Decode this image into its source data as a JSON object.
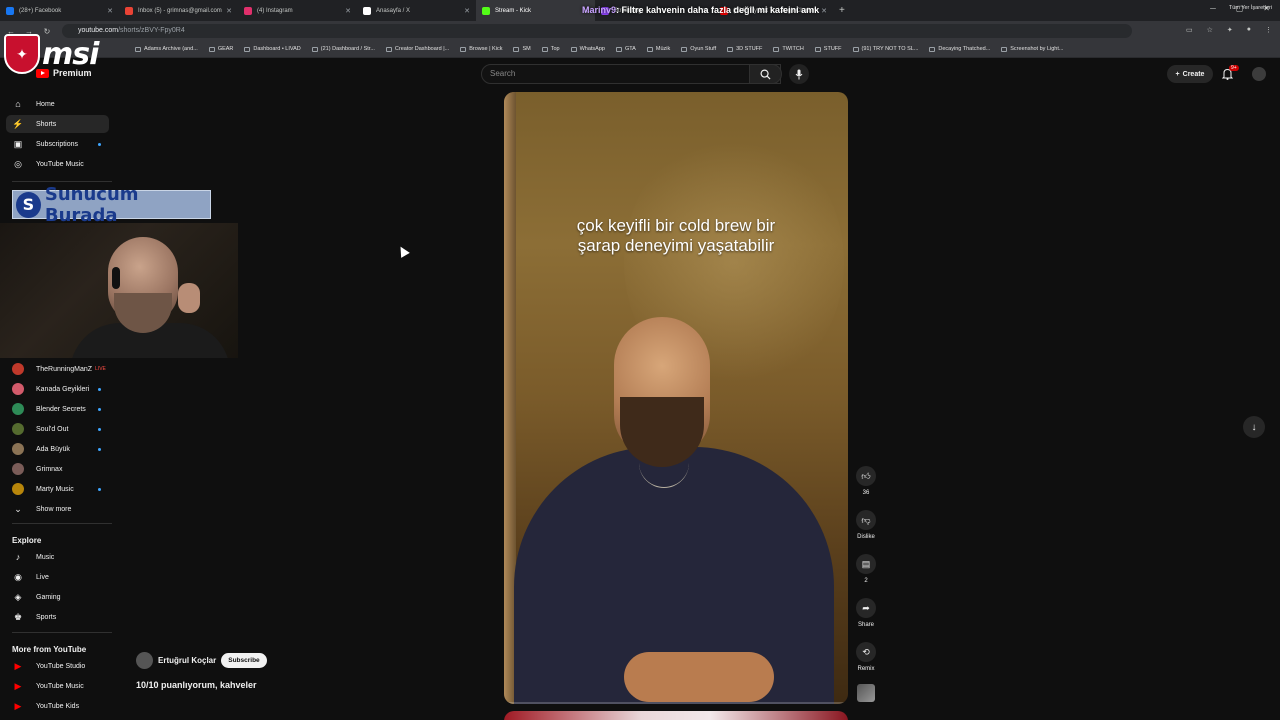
{
  "browser": {
    "tabs": [
      {
        "label": "(28+) Facebook",
        "color": "#1877f2"
      },
      {
        "label": "Inbox (5) - grimnas@gmail.com",
        "color": "#ea4335"
      },
      {
        "label": "(4) Instagram",
        "color": "#e1306c"
      },
      {
        "label": "Anasayfa / X",
        "color": "#ffffff"
      },
      {
        "label": "Stream - Kick",
        "color": "#53fc18"
      },
      {
        "label": "Streaming",
        "color": "#9146ff"
      },
      {
        "label": "(524) Try Not To Laugh Challen",
        "color": "#ff0000"
      }
    ],
    "url_host": "youtube.com",
    "url_path": "/shorts/zBVY-Fpy0R4",
    "bookmarks": [
      "Adams Archive (and...",
      "GEAR",
      "Dashboard • LIVAD",
      "(21) Dashboard / Str...",
      "Creator Dashboard |...",
      "Browse | Kick",
      "SM",
      "Top",
      "WhatsApp",
      "GTA",
      "Müzik",
      "Oyun Stuff",
      "3D STUFF",
      "TWITCH",
      "STUFF",
      "(91) TRY NOT TO SL...",
      "Decaying Thatched...",
      "Screenshot by Light..."
    ],
    "bookmarks_right": "Tüm Yer İşaretleri",
    "chat_overlay": {
      "user": "Marinv9",
      "message": ": Filtre kahvenin daha fazla değil mi kafeini amk"
    }
  },
  "msi_logo": "msi",
  "header": {
    "logo_text": "Premium",
    "search_placeholder": "Search",
    "create_label": "Create",
    "notif_count": "9+"
  },
  "sidebar": {
    "main": [
      {
        "label": "Home",
        "icon": "home-icon",
        "glyph": "⌂"
      },
      {
        "label": "Shorts",
        "icon": "shorts-icon",
        "glyph": "⚡"
      },
      {
        "label": "Subscriptions",
        "icon": "subscriptions-icon",
        "glyph": "▣"
      },
      {
        "label": "YouTube Music",
        "icon": "music-icon",
        "glyph": "◎"
      }
    ],
    "subscriptions": [
      {
        "label": "TheRunningManZ",
        "color": "#c0392b",
        "live": "LIVE"
      },
      {
        "label": "Kanada Geyikleri",
        "color": "#d35b6b"
      },
      {
        "label": "Blender Secrets",
        "color": "#2e8b57"
      },
      {
        "label": "Soul'd Out",
        "color": "#556b2f"
      },
      {
        "label": "Ada Büyük",
        "color": "#8b7355"
      },
      {
        "label": "Grimnax",
        "color": "#7a5c58"
      },
      {
        "label": "Marty Music",
        "color": "#b8860b"
      }
    ],
    "show_more": "Show more",
    "explore_title": "Explore",
    "explore": [
      {
        "label": "Music",
        "icon": "music-note-icon",
        "glyph": "♪"
      },
      {
        "label": "Live",
        "icon": "live-icon",
        "glyph": "◉"
      },
      {
        "label": "Gaming",
        "icon": "gaming-icon",
        "glyph": "◈"
      },
      {
        "label": "Sports",
        "icon": "trophy-icon",
        "glyph": "♚"
      }
    ],
    "more_title": "More from YouTube",
    "more": [
      {
        "label": "YouTube Studio"
      },
      {
        "label": "YouTube Music"
      },
      {
        "label": "YouTube Kids"
      }
    ]
  },
  "overlay_banner": {
    "letter": "S",
    "text": "Sunucum Burada"
  },
  "short": {
    "caption_line1": "çok keyifli bir cold brew bir",
    "caption_line2": "şarap deneyimi yaşatabilir",
    "channel": "Ertuğrul Koçlar",
    "subscribe": "Subscribe",
    "title": "10/10 puanlıyorum, kahveler",
    "progress": 0.01
  },
  "actions": {
    "likes": "36",
    "dislike": "Dislike",
    "comments": "2",
    "share": "Share",
    "remix": "Remix"
  }
}
